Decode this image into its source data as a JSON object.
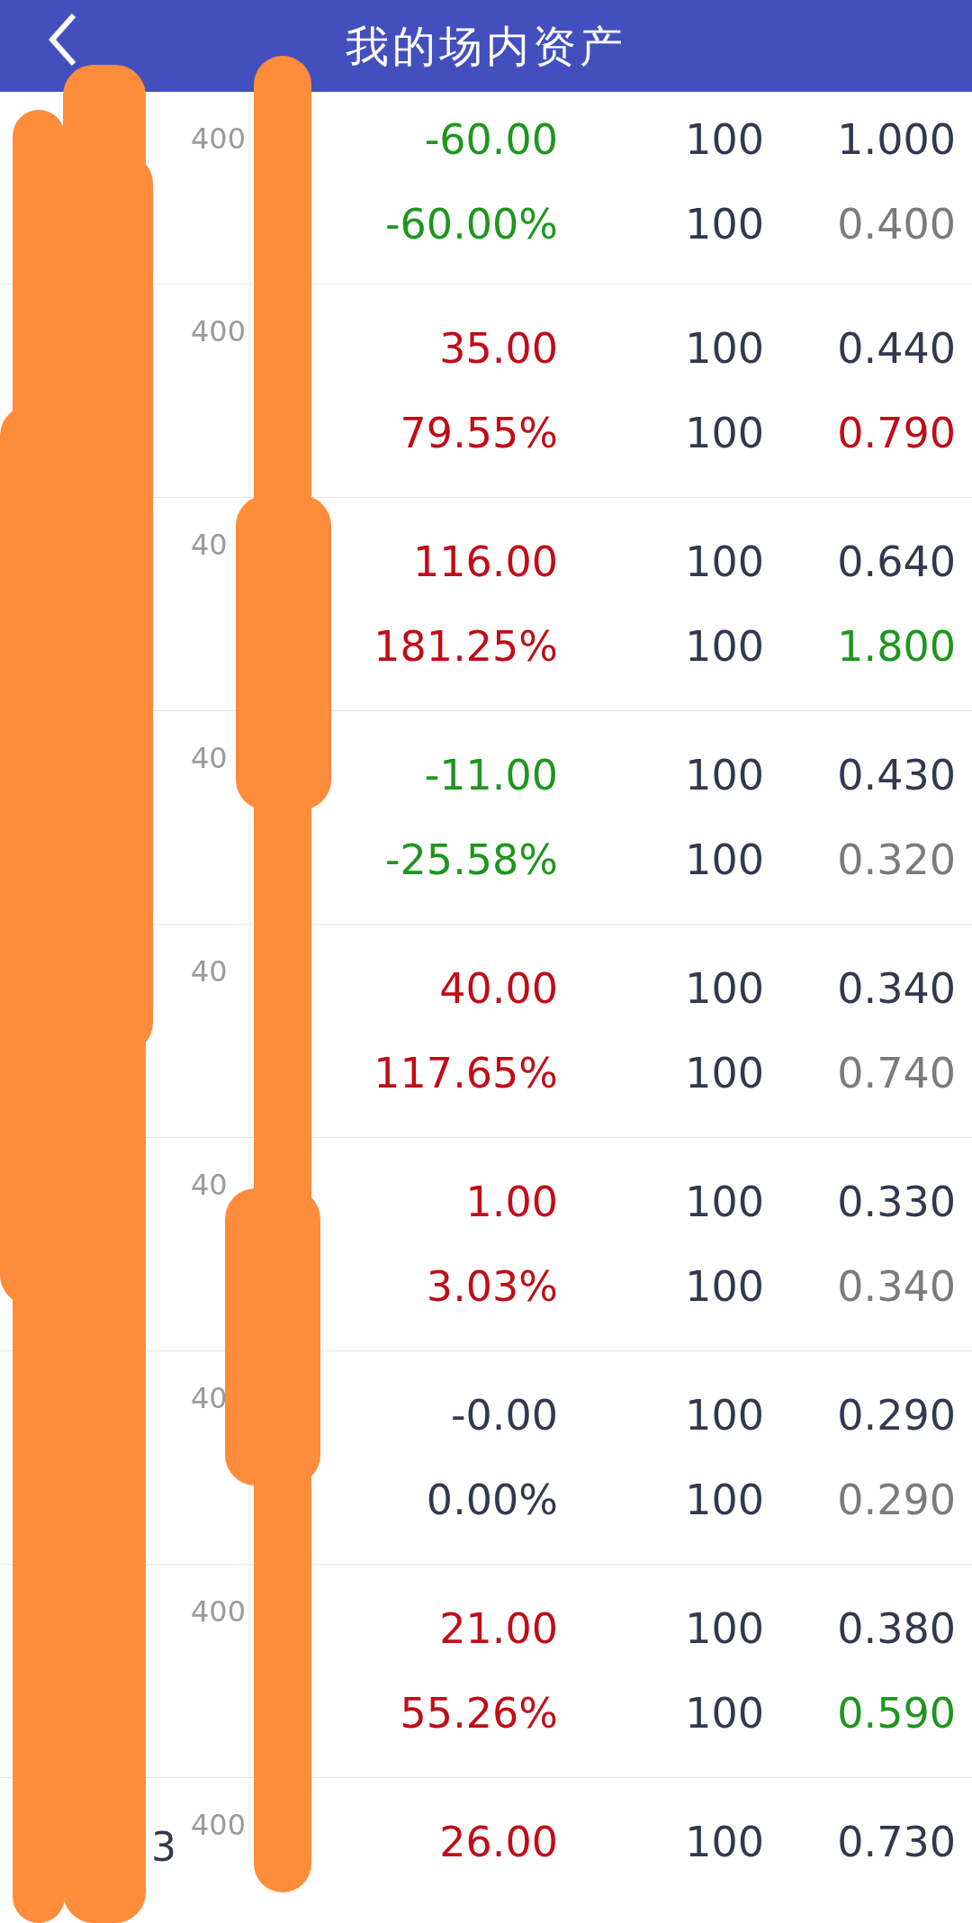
{
  "header": {
    "title": "我的场内资产"
  },
  "rows": [
    {
      "code": "400",
      "lines": [
        {
          "value": {
            "text": "-60.00",
            "color": "#1e961e"
          },
          "qty": "100",
          "price": {
            "text": "1.000",
            "color": "#33384f"
          }
        },
        {
          "value": {
            "text": "-60.00%",
            "color": "#1e961e"
          },
          "qty": "100",
          "price": {
            "text": "0.400",
            "color": "#7b7b7b"
          }
        }
      ]
    },
    {
      "code": "400",
      "lines": [
        {
          "value": {
            "text": "35.00",
            "color": "#c00d17"
          },
          "qty": "100",
          "price": {
            "text": "0.440",
            "color": "#33384f"
          }
        },
        {
          "value": {
            "text": "79.55%",
            "color": "#c00d17"
          },
          "qty": "100",
          "price": {
            "text": "0.790",
            "color": "#c00d17"
          }
        }
      ]
    },
    {
      "code": "40",
      "lines": [
        {
          "value": {
            "text": "116.00",
            "color": "#c00d17"
          },
          "qty": "100",
          "price": {
            "text": "0.640",
            "color": "#33384f"
          }
        },
        {
          "value": {
            "text": "181.25%",
            "color": "#c00d17"
          },
          "qty": "100",
          "price": {
            "text": "1.800",
            "color": "#1e961e"
          }
        }
      ]
    },
    {
      "code": "40",
      "lines": [
        {
          "value": {
            "text": "-11.00",
            "color": "#1e961e"
          },
          "qty": "100",
          "price": {
            "text": "0.430",
            "color": "#33384f"
          }
        },
        {
          "value": {
            "text": "-25.58%",
            "color": "#1e961e"
          },
          "qty": "100",
          "price": {
            "text": "0.320",
            "color": "#7b7b7b"
          }
        }
      ]
    },
    {
      "code": "40",
      "lines": [
        {
          "value": {
            "text": "40.00",
            "color": "#c00d17"
          },
          "qty": "100",
          "price": {
            "text": "0.340",
            "color": "#33384f"
          }
        },
        {
          "value": {
            "text": "117.65%",
            "color": "#c00d17"
          },
          "qty": "100",
          "price": {
            "text": "0.740",
            "color": "#7b7b7b"
          }
        }
      ]
    },
    {
      "code": "40",
      "lines": [
        {
          "value": {
            "text": "1.00",
            "color": "#c00d17"
          },
          "qty": "100",
          "price": {
            "text": "0.330",
            "color": "#33384f"
          }
        },
        {
          "value": {
            "text": "3.03%",
            "color": "#c00d17"
          },
          "qty": "100",
          "price": {
            "text": "0.340",
            "color": "#7b7b7b"
          }
        }
      ]
    },
    {
      "code": "40",
      "lines": [
        {
          "value": {
            "text": "-0.00",
            "color": "#33384f"
          },
          "qty": "100",
          "price": {
            "text": "0.290",
            "color": "#33384f"
          }
        },
        {
          "value": {
            "text": "0.00%",
            "color": "#33384f"
          },
          "qty": "100",
          "price": {
            "text": "0.290",
            "color": "#7b7b7b"
          }
        }
      ]
    },
    {
      "code": "400",
      "lines": [
        {
          "value": {
            "text": "21.00",
            "color": "#c00d17"
          },
          "qty": "100",
          "price": {
            "text": "0.380",
            "color": "#33384f"
          }
        },
        {
          "value": {
            "text": "55.26%",
            "color": "#c00d17"
          },
          "qty": "100",
          "price": {
            "text": "0.590",
            "color": "#1e961e"
          }
        }
      ]
    },
    {
      "name": "3",
      "code": "400",
      "lines": [
        {
          "value": {
            "text": "26.00",
            "color": "#c00d17"
          },
          "qty": "100",
          "price": {
            "text": "0.730",
            "color": "#33384f"
          }
        }
      ]
    }
  ]
}
